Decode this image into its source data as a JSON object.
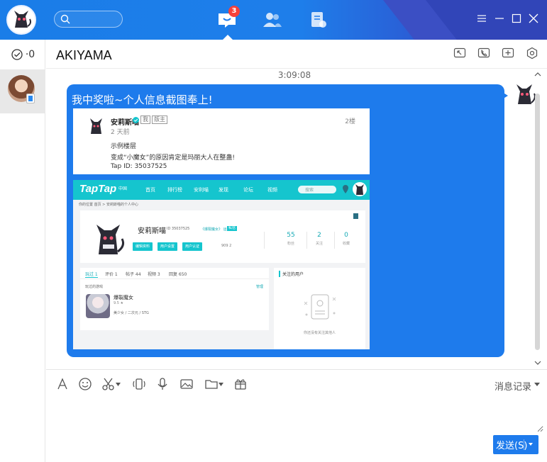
{
  "topbar": {
    "search_placeholder": "",
    "messages_badge": "3"
  },
  "task": {
    "count": "0"
  },
  "chat": {
    "title": "AKIYAMA",
    "timestamp": "3:09:08",
    "message_text": "我中奖啦~个人信息截图奉上!"
  },
  "post": {
    "username": "安莉斯喵",
    "tag_me": "我",
    "tag_owner": "版主",
    "time": "2 天前",
    "floor": "2楼",
    "lines": [
      "示例楼层",
      "变成“小魔女”的原因肯定是玛丽大人在整蛊!",
      "Tap ID:  35037525"
    ]
  },
  "taptap": {
    "logo": "TapTap",
    "logo_sub": "中国",
    "nav": [
      "首页",
      "排行榜",
      "发现",
      "论坛",
      "视频"
    ],
    "nav_highlight": "安利喵",
    "search_placeholder": "搜索",
    "breadcrumb": "你的位置  首页  >  安莉斯喵的个人中心",
    "profile": {
      "name": "安莉斯喵",
      "id_text": "ID 35037525",
      "link_text": "《爆裂魔女》 运营",
      "badge": "私信",
      "buttons": [
        "编辑资料",
        "用户设置",
        "用户认证"
      ],
      "stats_text": "909   2",
      "stats": [
        {
          "value": "55",
          "label": "粉丝"
        },
        {
          "value": "2",
          "label": "关注"
        },
        {
          "value": "0",
          "label": "收藏"
        }
      ]
    },
    "tabs": [
      "玩过 1",
      "评价 1",
      "帖子 44",
      "视频 3",
      "回复 650"
    ],
    "played_label": "玩过的游戏",
    "manage_label": "管理",
    "game": {
      "name": "爆裂魔女",
      "score": "9.5 ★",
      "tags": "美少女 / 二次元 / STG"
    },
    "following_title": "关注的用户",
    "empty_text": "你还没有关注其他人"
  },
  "input": {
    "history_label": "消息记录",
    "send_label": "发送(S)"
  },
  "colors": {
    "accent": "#1e7bec",
    "taptap": "#15c5ce",
    "badge": "#f5413b"
  }
}
